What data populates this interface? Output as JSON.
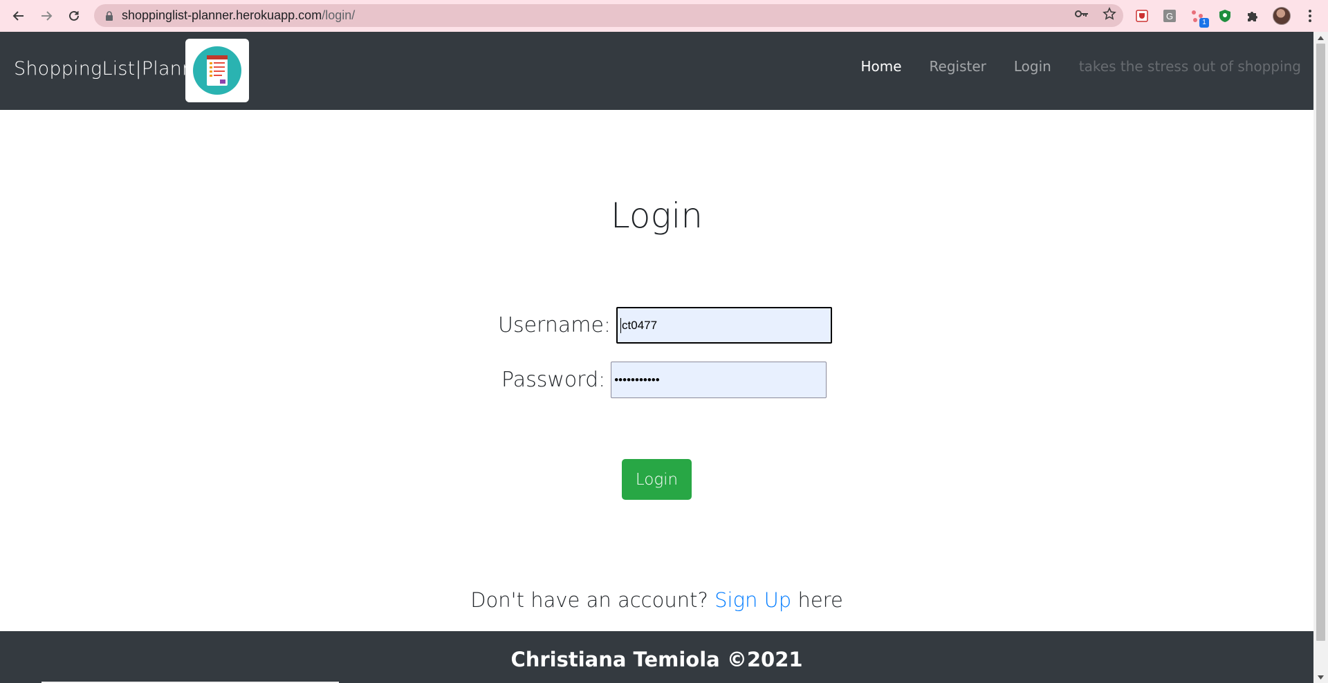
{
  "browser": {
    "url_host": "shoppinglist-planner.herokuapp.com",
    "url_path": "/login/",
    "extension_badge": "1"
  },
  "navbar": {
    "brand": "ShoppingList|Planner",
    "links": {
      "home": "Home",
      "register": "Register",
      "login": "Login"
    },
    "tagline": "takes the stress out of shopping"
  },
  "login_form": {
    "title": "Login",
    "username_label": "Username:",
    "username_value": "ct0477",
    "password_label": "Password:",
    "password_value": "•••••••••••",
    "submit_label": "Login"
  },
  "signup_prompt": {
    "prefix": "Don't have an account?",
    "link": "Sign Up",
    "suffix": "here"
  },
  "footer": {
    "text": "Christiana Temiola ©2021"
  },
  "colors": {
    "navbar_bg": "#343a40",
    "login_button": "#28a745",
    "link": "#007bff",
    "input_autofill_bg": "#e8f0fe"
  }
}
